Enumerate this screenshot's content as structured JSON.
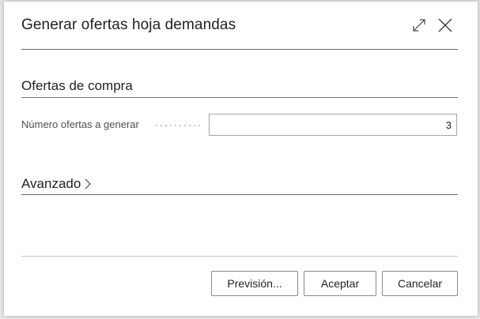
{
  "dialog": {
    "title": "Generar ofertas hoja demandas",
    "icons": {
      "expand": "expand-icon",
      "close": "close-icon"
    }
  },
  "section_purchase": {
    "title": "Ofertas de compra",
    "field_label": "Número ofertas a generar",
    "field_value": "3"
  },
  "section_advanced": {
    "title": "Avanzado",
    "icon": "chevron-right-icon"
  },
  "footer": {
    "preview_label": "Previsión...",
    "accept_label": "Aceptar",
    "cancel_label": "Cancelar"
  }
}
